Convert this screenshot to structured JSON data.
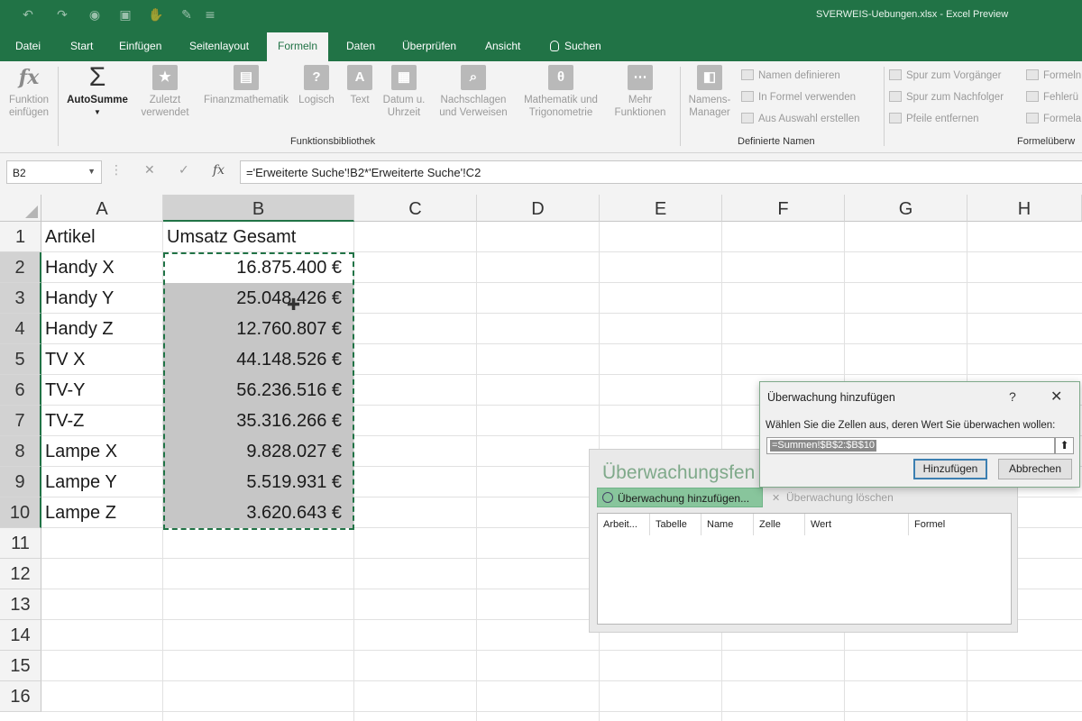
{
  "window": {
    "title": "SVERWEIS-Uebungen.xlsx  -  Excel Preview"
  },
  "quick_access": [
    {
      "name": "undo-icon",
      "glyph": "↶"
    },
    {
      "name": "redo-icon",
      "glyph": "↷"
    },
    {
      "name": "camera-icon",
      "glyph": "◉"
    },
    {
      "name": "save-icon",
      "glyph": "▣"
    },
    {
      "name": "touch-mode-icon",
      "glyph": "✋"
    },
    {
      "name": "format-painter-icon",
      "glyph": "✎"
    },
    {
      "name": "customize-icon",
      "glyph": "≡"
    }
  ],
  "tabs": [
    "Datei",
    "Start",
    "Einfügen",
    "Seitenlayout",
    "Formeln",
    "Daten",
    "Überprüfen",
    "Ansicht"
  ],
  "active_tab": "Formeln",
  "search_label": "Suchen",
  "ribbon": {
    "funktion_einfuegen": {
      "line1": "Funktion",
      "line2": "einfügen",
      "icon": "fx"
    },
    "autosumme": {
      "label": "AutoSumme",
      "icon": "Σ"
    },
    "zuletzt": {
      "line1": "Zuletzt",
      "line2": "verwendet"
    },
    "finanz": {
      "line1": "Finanzmathematik"
    },
    "logisch": {
      "line1": "Logisch",
      "icon": "?"
    },
    "text": {
      "line1": "Text",
      "icon": "A"
    },
    "datum": {
      "line1": "Datum u.",
      "line2": "Uhrzeit"
    },
    "nachschlagen": {
      "line1": "Nachschlagen",
      "line2": "und Verweisen"
    },
    "mathematik": {
      "line1": "Mathematik und",
      "line2": "Trigonometrie"
    },
    "mehr": {
      "line1": "Mehr",
      "line2": "Funktionen"
    },
    "group_funktionsbibliothek": "Funktionsbibliothek",
    "namens_manager": {
      "line1": "Namens-",
      "line2": "Manager"
    },
    "namen_definieren": "Namen definieren",
    "in_formel_verwenden": "In Formel verwenden",
    "aus_auswahl_erstellen": "Aus Auswahl erstellen",
    "group_definierte_namen": "Definierte Namen",
    "spur_vorgaenger": "Spur zum Vorgänger",
    "spur_nachfolger": "Spur zum Nachfolger",
    "pfeile_entfernen": "Pfeile entfernen",
    "formeln_cut": "Formeln",
    "fehlerue_cut": "Fehlerü",
    "formelauswert_cut": "Formela",
    "group_formelueberwachung": "Formelüberw"
  },
  "formula_bar": {
    "name_box": "B2",
    "formula": "='Erweiterte Suche'!B2*'Erweiterte Suche'!C2"
  },
  "columns": [
    "A",
    "B",
    "C",
    "D",
    "E",
    "F",
    "G",
    "H"
  ],
  "rows": [
    "1",
    "2",
    "3",
    "4",
    "5",
    "6",
    "7",
    "8",
    "9",
    "10",
    "11",
    "12",
    "13",
    "14",
    "15",
    "16"
  ],
  "sheet": {
    "header_a": "Artikel",
    "header_b": "Umsatz Gesamt",
    "items": [
      {
        "artikel": "Handy X",
        "umsatz": "16.875.400 €"
      },
      {
        "artikel": "Handy Y",
        "umsatz": "25.048.426 €"
      },
      {
        "artikel": "Handy Z",
        "umsatz": "12.760.807 €"
      },
      {
        "artikel": "TV X",
        "umsatz": "44.148.526 €"
      },
      {
        "artikel": "TV-Y",
        "umsatz": "56.236.516 €"
      },
      {
        "artikel": "TV-Z",
        "umsatz": "35.316.266 €"
      },
      {
        "artikel": "Lampe X",
        "umsatz": "9.828.027 €"
      },
      {
        "artikel": "Lampe Y",
        "umsatz": "5.519.931 €"
      },
      {
        "artikel": "Lampe Z",
        "umsatz": "3.620.643 €"
      }
    ]
  },
  "watch_window": {
    "title": "Überwachungsfen",
    "add_button": "Überwachung hinzufügen...",
    "delete_button": "Überwachung löschen",
    "columns": [
      "Arbeit...",
      "Tabelle",
      "Name",
      "Zelle",
      "Wert",
      "Formel"
    ]
  },
  "dialog": {
    "title": "Überwachung hinzufügen",
    "help": "?",
    "prompt": "Wählen Sie die Zellen aus, deren Wert Sie überwachen wollen:",
    "reference": "=Summen!$B$2:$B$10",
    "ok": "Hinzufügen",
    "cancel": "Abbrechen"
  },
  "colors": {
    "accent": "#217346",
    "selection": "#c6c6c6"
  }
}
